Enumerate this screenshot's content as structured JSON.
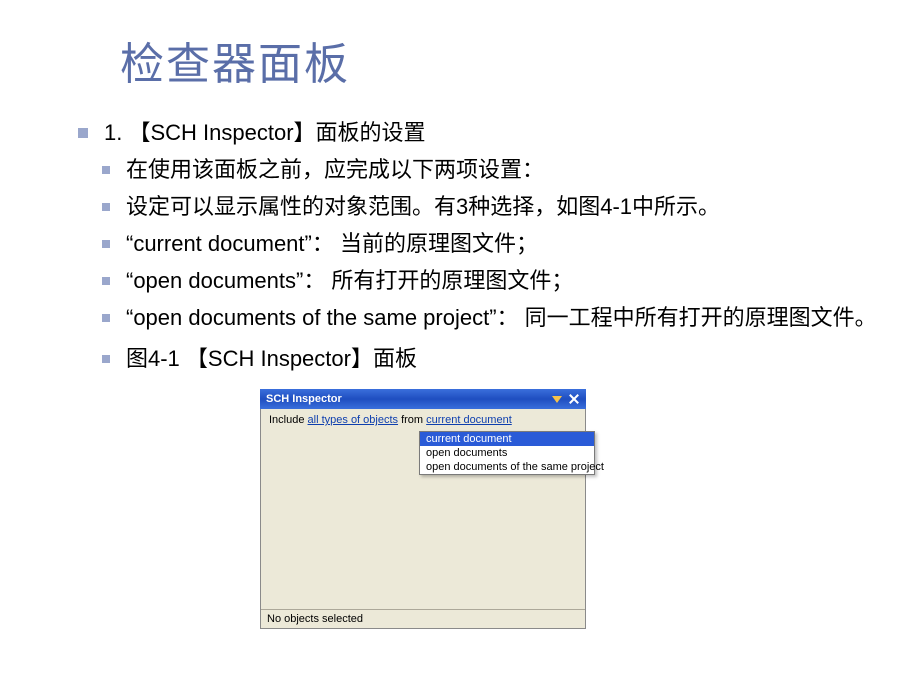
{
  "title": "检查器面板",
  "bullets": {
    "b1": "1. 【SCH Inspector】面板的设置",
    "b2": "在使用该面板之前，应完成以下两项设置：",
    "b3": "设定可以显示属性的对象范围。有3种选择，如图4-1中所示。",
    "b4": "“current document”： 当前的原理图文件；",
    "b5": "“open documents”： 所有打开的原理图文件；",
    "b6": "“open documents of the same project”： 同一工程中所有打开的原理图文件。",
    "caption": "图4-1 【SCH Inspector】面板"
  },
  "inspector": {
    "window_title": "SCH Inspector",
    "filter_prefix": "Include ",
    "filter_types": "all types of objects",
    "filter_from": " from ",
    "filter_scope": "current document",
    "options": {
      "o1": "current document",
      "o2": "open documents",
      "o3": "open documents of the same project"
    },
    "status": "No objects selected"
  }
}
